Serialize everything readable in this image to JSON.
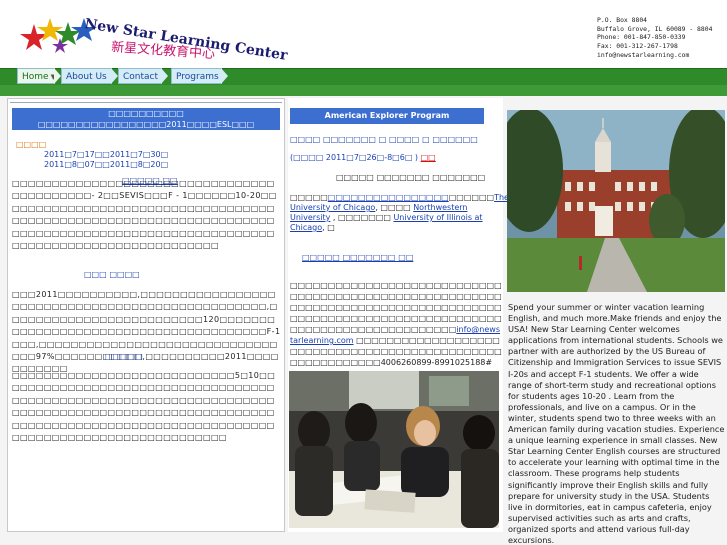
{
  "header": {
    "logo_en": "New Star Learning Center",
    "logo_zh": "新星文化教育中心",
    "contact_lines": [
      "P.O. Box 8804",
      "Buffalo Grove, IL 60089 - 8804",
      "Phone: 001-847-850-0339",
      "Fax: 001-312-267-1798",
      "info@newstarlearning.com"
    ]
  },
  "nav": {
    "tabs": [
      {
        "label": "Home",
        "has_caret": true
      },
      {
        "label": "About Us"
      },
      {
        "label": "Contact"
      },
      {
        "label": "Programs"
      }
    ]
  },
  "left": {
    "title_line1": "□□□□□□□□□□",
    "title_line2": "□□□□□□□□□□□□□□□□□2011□□□□ESL□□□",
    "date_head": "□□□□",
    "dates": [
      "2011□7□17□□2011□7□30□",
      "2011□8□07□□2011□8□20□"
    ],
    "links": "□□□□□  □□",
    "p1": "□□□□□□□□□□□□□□□□□□□□□□□□□□□□□□□□□□□□□□□□□□□- 2□□SEVIS□□□F - 1□□□□□□10-20□□□□□□□□□□□□□□□□□□□□□□□□□□□□□□□□□□□□□□□□□□□□□□□□□□□□□□□□□□□□□□□□□□□□□□□□□□□□□□□□□□□□□□□□□□□□□□□□□□□□□□□□□□□□□□□□□□□□□□□□□□□□□□□",
    "sub1": "□□□ □□□□",
    "p2": "□□□2011□□□□□□□□□□,□□□□□□□□□□□□□□□□□□□□□□□□□□□□□□□□□□□□□□□□□□□□□□□□□,□□□□□□□□□□□□□□□□□□□□□□□□□120□□□□□□□□□□□□□□□□□□□□□□□□□□□□□□□□□□□□□□□F-1□□□,□□□□□□□□□□□□□□□□□□□□□□□□□□□□□□□□□97%□□□□□□□□□□□,□□□□□□□□□□2011□□□□□□□□□□□",
    "sub2": "□□□□□",
    "p3": "□□□□□□□□□□□□□□□□□□□□□□□□□□□□5□10□□□□□□□□□□□□□□□□□□□□□□□□□□□□□□□□□□□□□□□□□□□□□□□□□□□□□□□□□□□□□□□□□□□□□□□□□□□□□□□□□□□□□□□□□□□□□□□□□□□□□□□□□□□□□□□□□□□□□□□□□□□□□□□□□□□□□□□□□□□□□□□□□□□□□□□□□□□□□□□□□"
  },
  "middle": {
    "title": "American Explorer Program",
    "line1": "□□□□ □□□□□□□ □ □□□□ □ □□□□□□",
    "line2_prefix": "(□□□□ 2011□7□26□-8□6□ )",
    "line2_red": "□□",
    "line3": "□□□□□  □□□□□□□  □□□□□□□",
    "p1_a": "□□□□□",
    "p1_link1": "□□□□□□□□□□□□□□□□",
    "p1_b": "□□□□□□",
    "p1_link2": "The University of Chicago",
    "p1_c": ", □□□□ ",
    "p1_link3": "Northwestern University",
    "p1_d": " , □□□□□□□ ",
    "p1_link4": "University of Illinois at Chicago",
    "p1_e": ", □",
    "links": "□□□□□   □□□□□□□   □□",
    "p2_a": "□□□□□□□□□□□□□□□□□□□□□□□□□□□□□□□□□□□□□□□□□□□□□□□□□□□□□□□□□□□□□□□□□□□□□□□□□□□□□□□□□□□□□□□□□□□□□□□□□□□□□□□□□□□□□□□□□□□□□□□□□□□□□□□□□□□□□□",
    "p2_email": "info@newstarlearning.com",
    "p2_b": " □□□□□□□□□□□□□□□□□□□□□□□□□□□□□□□□□□□□□□□□□□□□□□□□□□□□□□□□□□□4006260899-8991025188# □□□□□□"
  },
  "right": {
    "text": "Spend your summer or winter vacation learning English, and much more.Make friends and enjoy the USA! New Star Learning Center welcomes applications from international students. Schools we partner with  are authorized by the US Bureau of Citizenship and Immigration Services to issue SEVIS I-20s and accept F-1 students. We offer a wide range of short-term study and  recreational options for students ages 10-20 . Learn from the professionals, and live on a campus. Or in the winter, students spend two to three weeks with an American family during vacation studies. Experience a unique learning experience in small classes. New Star Learning Center English courses are structured to accelerate your learning with optimal time in the classroom. These programs help students significantly improve their English skills and fully prepare for university study in the USA. Students live in dormitories, eat in campus cafeteria, enjoy supervised activities such as arts and crafts, organized sports and attend various full-day excursions."
  },
  "colors": {
    "nav_green": "#2f8a2a",
    "title_blue": "#3d6fd0",
    "link_blue": "#1a3fb0",
    "date_orange": "#e07000",
    "highlight_red": "#d01010"
  }
}
